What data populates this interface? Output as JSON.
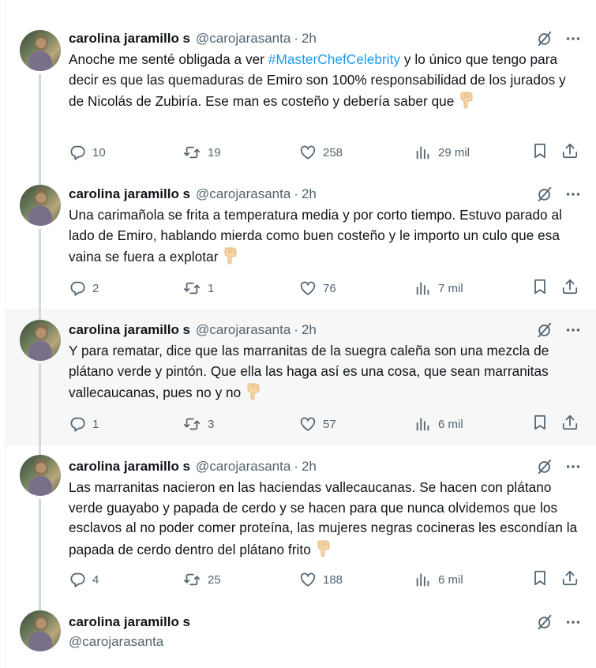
{
  "tweets": [
    {
      "name": "carolina jaramillo s",
      "handle": "@carojarasanta",
      "time": "2h",
      "text_parts": [
        {
          "t": "Anoche me senté obligada a ver "
        },
        {
          "t": "#MasterChefCelebrity",
          "hashtag": true
        },
        {
          "t": " y lo único que tengo para decir es que las quemaduras de Emiro son 100% responsabilidad de los jurados y de Nicolás de Zubiría. Ese man es costeño y debería saber que "
        }
      ],
      "emoji": "hand-pointing-down-emoji",
      "replies": "10",
      "reposts": "19",
      "likes": "258",
      "views": "29 mil"
    },
    {
      "name": "carolina jaramillo s",
      "handle": "@carojarasanta",
      "time": "2h",
      "text_parts": [
        {
          "t": "Una carimañola se frita a temperatura media y por corto tiempo. Estuvo parado al lado de Emiro, hablando mierda como buen costeño y le importo un culo que esa vaina se fuera a explotar "
        }
      ],
      "emoji": "hand-pointing-down-emoji",
      "replies": "2",
      "reposts": "1",
      "likes": "76",
      "views": "7 mil"
    },
    {
      "name": "carolina jaramillo s",
      "handle": "@carojarasanta",
      "time": "2h",
      "text_parts": [
        {
          "t": "Y para rematar, dice que las marranitas de la suegra caleña son una mezcla de plátano verde y pintón. Que ella las haga así es una cosa, que sean marranitas vallecaucanas, pues no y no "
        }
      ],
      "emoji": "hand-pointing-down-emoji",
      "replies": "1",
      "reposts": "3",
      "likes": "57",
      "views": "6 mil"
    },
    {
      "name": "carolina jaramillo s",
      "handle": "@carojarasanta",
      "time": "2h",
      "text_parts": [
        {
          "t": "Las marranitas nacieron en las haciendas vallecaucanas. Se hacen con plátano verde guayabo y papada de cerdo y se hacen para que nunca olvidemos que los esclavos al no poder comer proteína, las mujeres negras cocineras les escondían la papada de cerdo dentro del plátano frito "
        }
      ],
      "emoji": "hand-pointing-down-emoji",
      "replies": "4",
      "reposts": "25",
      "likes": "188",
      "views": "6 mil"
    }
  ],
  "last_tweet": {
    "name": "carolina jaramillo s",
    "handle": "@carojarasanta"
  },
  "icons": {
    "grok": "grok-slash-icon",
    "more": "more-dots-icon",
    "reply": "reply-bubble-icon",
    "repost": "repost-icon",
    "like": "heart-icon",
    "views": "views-bars-icon",
    "bookmark": "bookmark-icon",
    "share": "share-upload-icon"
  },
  "colors": {
    "text": "#0f1419",
    "secondary": "#536471",
    "hashtag": "#1d9bf0",
    "thread_line": "#cfd9de",
    "highlight_bg": "#f7f7f7"
  }
}
